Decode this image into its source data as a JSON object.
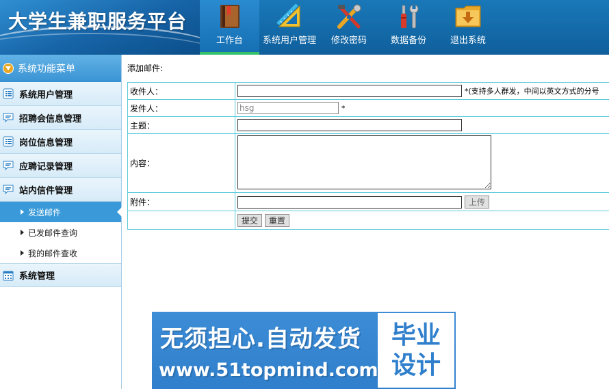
{
  "app": {
    "title": "大学生兼职服务平台"
  },
  "nav": {
    "items": [
      {
        "label": "工作台",
        "icon": "book-icon",
        "active": true
      },
      {
        "label": "系统用户管理",
        "icon": "ruler-triangle-icon",
        "active": false
      },
      {
        "label": "修改密码",
        "icon": "tools-icon",
        "active": false
      },
      {
        "label": "数据备份",
        "icon": "screwdriver-wrench-icon",
        "active": false
      },
      {
        "label": "退出系统",
        "icon": "folder-download-icon",
        "active": false
      }
    ]
  },
  "sidebar": {
    "header": "系统功能菜单",
    "items": [
      {
        "label": "系统用户管理",
        "icon": "list-icon"
      },
      {
        "label": "招聘会信息管理",
        "icon": "chat-bubble-icon"
      },
      {
        "label": "岗位信息管理",
        "icon": "list-icon"
      },
      {
        "label": "应聘记录管理",
        "icon": "chat-bubble-icon"
      },
      {
        "label": "站内信件管理",
        "icon": "chat-bubble-icon"
      }
    ],
    "subitems": [
      {
        "label": "发送邮件",
        "active": true
      },
      {
        "label": "已发邮件查询",
        "active": false
      },
      {
        "label": "我的邮件查收",
        "active": false
      }
    ],
    "last_item": {
      "label": "系统管理",
      "icon": "calendar-icon"
    }
  },
  "page": {
    "breadcrumb": "添加邮件:"
  },
  "form": {
    "recipient_label": "收件人：",
    "recipient_value": "",
    "recipient_hint": "*(支持多人群发，中间以英文方式的分号",
    "sender_label": "发件人：",
    "sender_value": "hsg",
    "sender_required": "*",
    "subject_label": "主题：",
    "subject_value": "",
    "content_label": "内容：",
    "content_value": "",
    "attachment_label": "附件：",
    "attachment_value": "",
    "upload_label": "上传",
    "submit_label": "提交",
    "reset_label": "重置"
  },
  "banner": {
    "slogan": "无须担心.自动发货",
    "url": "www.51topmind.com",
    "stamp_line1": "毕业",
    "stamp_line2": "设计"
  },
  "colors": {
    "header_blue": "#1670b4",
    "active_underline": "#35c06a",
    "sidebar_active": "#3a9ad9",
    "table_border": "#59c9d8"
  }
}
